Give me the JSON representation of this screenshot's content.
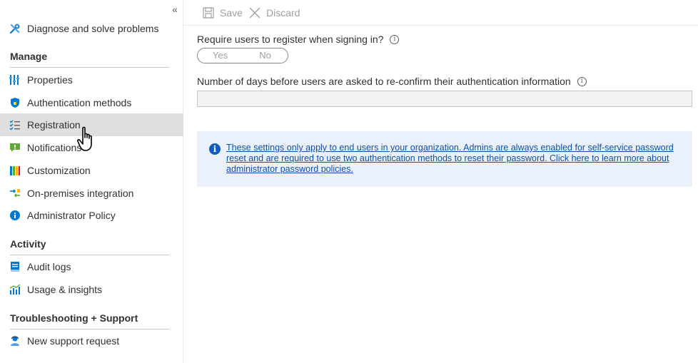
{
  "sidebar": {
    "collapse_glyph": "«",
    "top_item": {
      "label": "Diagnose and solve problems",
      "icon": "wrench-icon"
    },
    "sections": [
      {
        "title": "Manage",
        "items": [
          {
            "label": "Properties",
            "icon": "properties-icon"
          },
          {
            "label": "Authentication methods",
            "icon": "shield-icon"
          },
          {
            "label": "Registration",
            "icon": "checklist-icon",
            "selected": true
          },
          {
            "label": "Notifications",
            "icon": "notification-icon"
          },
          {
            "label": "Customization",
            "icon": "customization-icon"
          },
          {
            "label": "On-premises integration",
            "icon": "integration-icon"
          },
          {
            "label": "Administrator Policy",
            "icon": "info-icon"
          }
        ]
      },
      {
        "title": "Activity",
        "items": [
          {
            "label": "Audit logs",
            "icon": "audit-log-icon"
          },
          {
            "label": "Usage & insights",
            "icon": "insights-icon"
          }
        ]
      },
      {
        "title": "Troubleshooting + Support",
        "items": [
          {
            "label": "New support request",
            "icon": "support-person-icon"
          }
        ]
      }
    ]
  },
  "toolbar": {
    "save_label": "Save",
    "discard_label": "Discard"
  },
  "main": {
    "require_register_label": "Require users to register when signing in?",
    "toggle": {
      "yes": "Yes",
      "no": "No"
    },
    "reconfirm_label": "Number of days before users are asked to re-confirm their authentication information",
    "reconfirm_value": "",
    "info_message": "These settings only apply to end users in your organization. Admins are always enabled for self-service password reset and are required to use two authentication methods to reset their password. Click here to learn more about administrator password policies."
  },
  "colors": {
    "selected_bg": "#e1dfdd",
    "info_bg": "#eaf1fb",
    "link": "#0f4fa8",
    "info_icon": "#0f5cc5"
  }
}
